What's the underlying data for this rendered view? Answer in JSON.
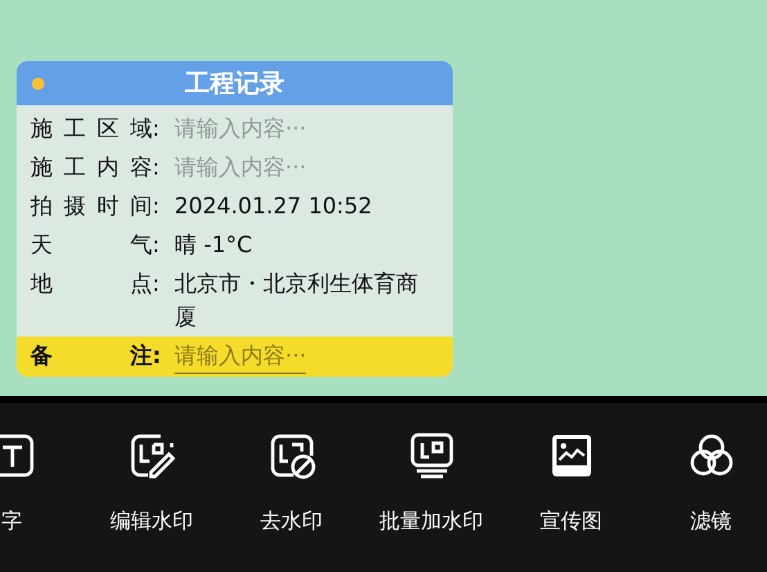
{
  "card": {
    "title": "工程记录",
    "rows": [
      {
        "label": "施工区域",
        "sep": ":",
        "placeholder": "请输入内容···",
        "highlighted": false
      },
      {
        "label": "施工内容",
        "sep": ":",
        "placeholder": "请输入内容···",
        "highlighted": false
      },
      {
        "label": "拍摄时间",
        "sep": ":",
        "value": "2024.01.27 10:52",
        "highlighted": false
      },
      {
        "label": "天气",
        "sep": ":",
        "value": "晴 -1°C",
        "highlighted": false
      },
      {
        "label": "地点",
        "sep": ":",
        "value": "北京市・北京利生体育商厦",
        "highlighted": false
      },
      {
        "label": "备注",
        "sep": ":",
        "placeholder": "请输入内容···",
        "highlighted": true
      }
    ]
  },
  "toolbar": [
    {
      "kind": "text",
      "label": "字"
    },
    {
      "kind": "edit",
      "label": "编辑水印"
    },
    {
      "kind": "remove",
      "label": "去水印"
    },
    {
      "kind": "batch",
      "label": "批量加水印"
    },
    {
      "kind": "poster",
      "label": "宣传图"
    },
    {
      "kind": "filter",
      "label": "滤镜"
    }
  ]
}
